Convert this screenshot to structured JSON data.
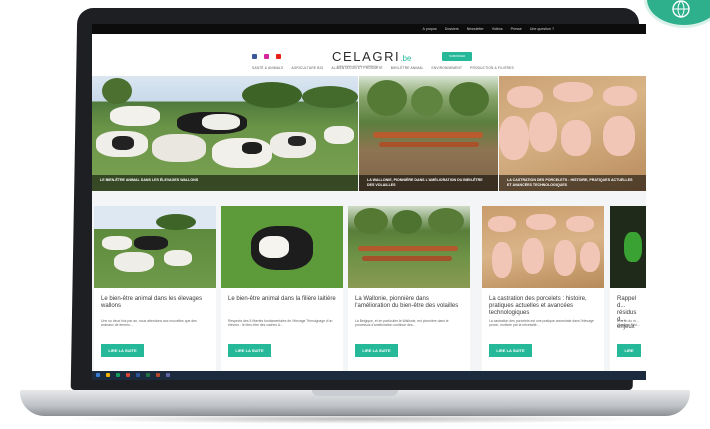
{
  "topbar": {
    "links": [
      "A propos",
      "Dossiers",
      "Newsletter",
      "Vidéos",
      "Presse",
      "Une question ?"
    ]
  },
  "header": {
    "logo_text": "CELAGRI",
    "logo_suffix": ".be",
    "logo_tagline": "l'information agricole en Wallonie",
    "subscribe_label": "S'ABONNER",
    "social_icons": [
      "facebook-icon",
      "instagram-icon",
      "youtube-icon"
    ]
  },
  "nav": {
    "items": [
      "SANTÉ & ANIMALS",
      "AGRICULTURE BIO",
      "ALIMENTATION ET PROXIMITÉ",
      "BIEN-ÊTRE ANIMAL",
      "ENVIRONNEMENT",
      "PRODUCTION & FILIÈRES"
    ]
  },
  "hero": [
    {
      "caption": "LE BIEN-ÊTRE ANIMAL DANS LES ÉLEVAGES WALLONS"
    },
    {
      "caption": "LA WALLONIE, PIONNIÈRE DANS L'AMÉLIORATION DU BIEN-ÊTRE DES VOLAILLES"
    },
    {
      "caption": "LA CASTRATION DES PORCELETS : HISTOIRE, PRATIQUES ACTUELLES ET AVANCÉES TECHNOLOGIQUES"
    }
  ],
  "cards": [
    {
      "title": "Le bien-être animal dans les élevages wallons",
      "excerpt": "Une ou deux fois par an, nous attendons aux nouvelles que des animaux de fermes...",
      "button": "LIRE LA SUITE"
    },
    {
      "title": "Le bien-être animal dans la filière laitière",
      "excerpt": "Respects des 5 libertés fondamentales de l'élevage Témoignage d'un éleveur : le bien-être des vaches &...",
      "button": "LIRE LA SUITE"
    },
    {
      "title": "La Wallonie, pionnière dans l'amélioration du bien-être des volailles",
      "excerpt": "La Belgique, et en particulier la Wallonie, est pionnière dans le processus d'amélioration continue des...",
      "button": "LIRE LA SUITE"
    },
    {
      "title": "La castration des porcelets : histoire, pratiques actuelles et avancées technologiques",
      "excerpt": "La castration des porcelets est une pratique ancestrale dans l'élevage porcin, motivée par la nécessité...",
      "button": "LIRE LA SUITE"
    },
    {
      "title": "Rappel d... résidus d... enjeux",
      "excerpt": "À la fin du m... l'Agence Féd...",
      "button": "LIRE"
    }
  ],
  "colors": {
    "accent": "#25b99a",
    "topbar": "#0c0c0c",
    "taskbar": "#1b2a3c"
  }
}
